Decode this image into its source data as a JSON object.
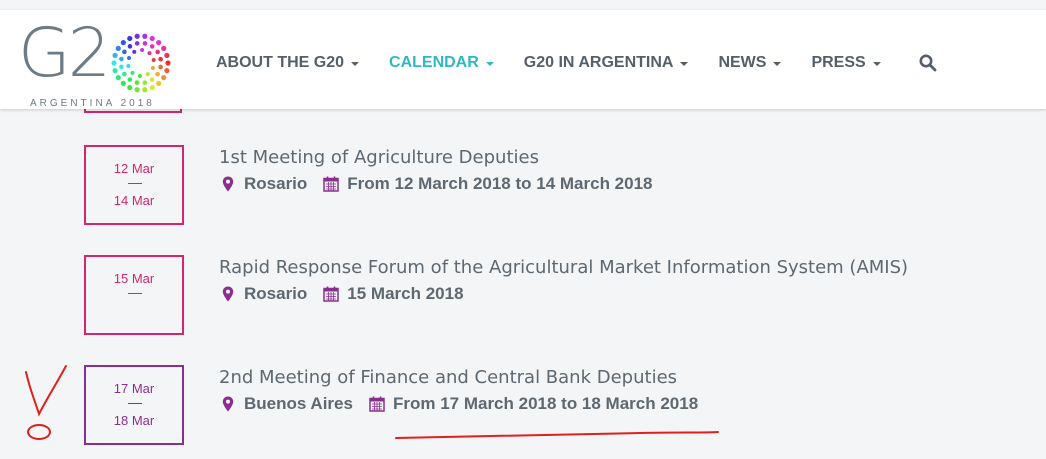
{
  "header": {
    "logo_text": "G2",
    "logo_subtitle": "ARGENTINA 2018",
    "nav": [
      {
        "label": "ABOUT THE G20",
        "active": false
      },
      {
        "label": "CALENDAR",
        "active": true
      },
      {
        "label": "G20 IN ARGENTINA",
        "active": false
      },
      {
        "label": "NEWS",
        "active": false
      },
      {
        "label": "PRESS",
        "active": false
      }
    ],
    "search_icon": "search-icon"
  },
  "events": [
    {
      "date_start": "12 Mar",
      "date_end": "14 Mar",
      "title": "1st Meeting of Agriculture Deputies",
      "location": "Rosario",
      "dates": "From 12 March 2018 to 14 March 2018",
      "color": "#d6246e"
    },
    {
      "date_start": "15 Mar",
      "date_end": "",
      "title": "Rapid Response Forum of the Agricultural Market Information System (AMIS)",
      "location": "Rosario",
      "dates": "15 March 2018",
      "color": "#d6246e"
    },
    {
      "date_start": "17 Mar",
      "date_end": "18 Mar",
      "title": "2nd Meeting of Finance and Central Bank Deputies",
      "location": "Buenos Aires",
      "dates": "From 17 March 2018 to 18 March 2018",
      "color": "#8a2f8e"
    }
  ],
  "colors": {
    "accent": "#2fb8c2",
    "nav_text": "#555f6a",
    "magenta": "#d6246e",
    "purple": "#8a2f8e",
    "annotation_red": "#e0201a"
  }
}
